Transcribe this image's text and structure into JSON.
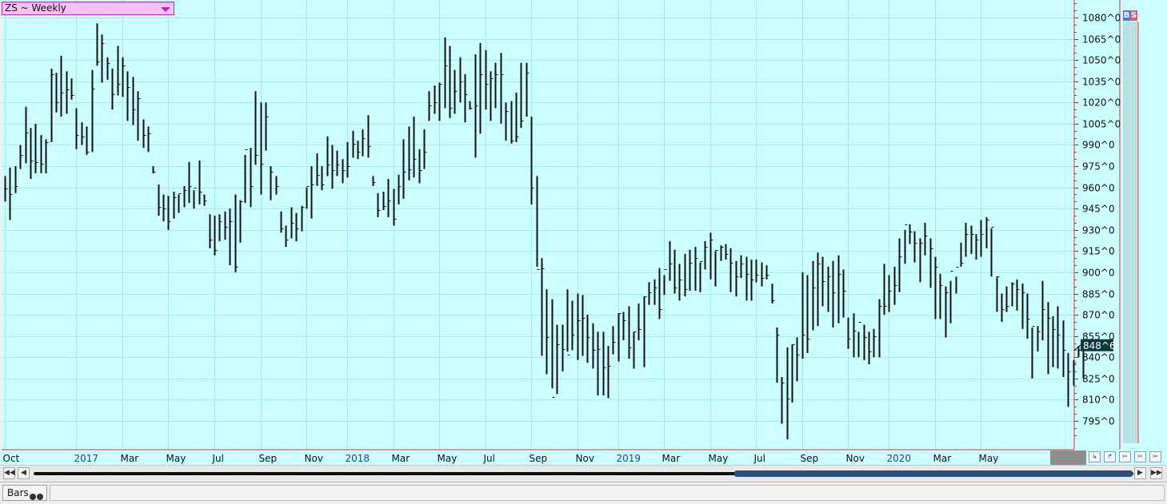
{
  "header": {
    "symbol_label": "ZS ~ Weekly"
  },
  "buy_sell": {
    "buy": "B",
    "sell": "S"
  },
  "status": {
    "tab_label": "Bars"
  },
  "colors": {
    "plot_bg": "#ccffff",
    "bar": "#111111",
    "axis": "#e03030",
    "grid": "#a8e8ee",
    "year_label": "#1a3fbf",
    "last_price_bg": "#0d3b3b"
  },
  "icons": [
    "link-icon",
    "unlink-icon",
    "zoom-in-icon",
    "zoom-out-icon",
    "reset-zoom-icon"
  ],
  "chart_data": {
    "type": "ohlc",
    "title": "ZS ~ Weekly",
    "y_unit": "cents^eighths",
    "ylim": [
      779,
      1091
    ],
    "y_ticks": [
      "1080^0",
      "1065^0",
      "1050^0",
      "1035^0",
      "1020^0",
      "1005^0",
      "990^0",
      "975^0",
      "960^0",
      "945^0",
      "930^0",
      "915^0",
      "900^0",
      "885^0",
      "870^0",
      "855^0",
      "840^0",
      "825^0",
      "810^0",
      "795^0"
    ],
    "x_ticks": [
      {
        "label": "Oct",
        "week": 0,
        "year": false
      },
      {
        "label": "2017",
        "week": 14,
        "year": true
      },
      {
        "label": "Mar",
        "week": 23,
        "year": false
      },
      {
        "label": "May",
        "week": 32,
        "year": false
      },
      {
        "label": "Jul",
        "week": 41,
        "year": false
      },
      {
        "label": "Sep",
        "week": 50,
        "year": false
      },
      {
        "label": "Nov",
        "week": 59,
        "year": false
      },
      {
        "label": "2018",
        "week": 67,
        "year": true
      },
      {
        "label": "Mar",
        "week": 76,
        "year": false
      },
      {
        "label": "May",
        "week": 85,
        "year": false
      },
      {
        "label": "Jul",
        "week": 94,
        "year": false
      },
      {
        "label": "Sep",
        "week": 103,
        "year": false
      },
      {
        "label": "Nov",
        "week": 112,
        "year": false
      },
      {
        "label": "2019",
        "week": 120,
        "year": true
      },
      {
        "label": "Mar",
        "week": 129,
        "year": false
      },
      {
        "label": "May",
        "week": 138,
        "year": false
      },
      {
        "label": "Jul",
        "week": 147,
        "year": false
      },
      {
        "label": "Sep",
        "week": 156,
        "year": false
      },
      {
        "label": "Nov",
        "week": 165,
        "year": false
      },
      {
        "label": "2020",
        "week": 173,
        "year": true
      },
      {
        "label": "Mar",
        "week": 182,
        "year": false
      },
      {
        "label": "May",
        "week": 191,
        "year": false
      }
    ],
    "last_price": {
      "label": "848^6",
      "value": 848.75
    },
    "grid": true,
    "legend": "none",
    "bars": [
      [
        968,
        950,
        959
      ],
      [
        974,
        937,
        955
      ],
      [
        975,
        956,
        961
      ],
      [
        990,
        973,
        983
      ],
      [
        1017,
        977,
        999
      ],
      [
        1002,
        966,
        979
      ],
      [
        1005,
        970,
        978
      ],
      [
        997,
        970,
        977
      ],
      [
        994,
        970,
        992
      ],
      [
        1044,
        992,
        1040
      ],
      [
        1041,
        1013,
        1020
      ],
      [
        1053,
        1010,
        1027
      ],
      [
        1042,
        1012,
        1029
      ],
      [
        1037,
        1022,
        1025
      ],
      [
        1016,
        987,
        997
      ],
      [
        1006,
        990,
        996
      ],
      [
        1003,
        983,
        985
      ],
      [
        1043,
        985,
        1030
      ],
      [
        1076,
        1046,
        1049
      ],
      [
        1068,
        1034,
        1062
      ],
      [
        1052,
        1036,
        1048
      ],
      [
        1044,
        1015,
        1026
      ],
      [
        1060,
        1025,
        1033
      ],
      [
        1052,
        1024,
        1046
      ],
      [
        1042,
        1007,
        1031
      ],
      [
        1038,
        1004,
        1015
      ],
      [
        1028,
        993,
        1023
      ],
      [
        1008,
        988,
        997
      ],
      [
        1003,
        985,
        998
      ],
      [
        975,
        970,
        971
      ],
      [
        962,
        940,
        946
      ],
      [
        955,
        936,
        945
      ],
      [
        954,
        930,
        936
      ],
      [
        957,
        938,
        953
      ],
      [
        955,
        942,
        956
      ],
      [
        961,
        946,
        958
      ],
      [
        978,
        949,
        961
      ],
      [
        958,
        945,
        960
      ],
      [
        979,
        948,
        957
      ],
      [
        955,
        947,
        951
      ],
      [
        941,
        917,
        923
      ],
      [
        940,
        912,
        916
      ],
      [
        941,
        922,
        936
      ],
      [
        943,
        923,
        932
      ],
      [
        945,
        905,
        936
      ],
      [
        955,
        900,
        904
      ],
      [
        951,
        921,
        950
      ],
      [
        983,
        949,
        987
      ],
      [
        988,
        946,
        961
      ],
      [
        1028,
        976,
        983
      ],
      [
        1020,
        955,
        977
      ],
      [
        1020,
        986,
        1010
      ],
      [
        975,
        951,
        971
      ],
      [
        968,
        955,
        961
      ],
      [
        943,
        928,
        931
      ],
      [
        933,
        918,
        923
      ],
      [
        946,
        924,
        935
      ],
      [
        942,
        922,
        931
      ],
      [
        947,
        929,
        946
      ],
      [
        960,
        945,
        961
      ],
      [
        975,
        938,
        962
      ],
      [
        984,
        961,
        969
      ],
      [
        975,
        958,
        962
      ],
      [
        996,
        968,
        976
      ],
      [
        990,
        959,
        972
      ],
      [
        986,
        968,
        976
      ],
      [
        980,
        963,
        972
      ],
      [
        992,
        967,
        975
      ],
      [
        1000,
        981,
        991
      ],
      [
        993,
        980,
        985
      ],
      [
        1001,
        982,
        995
      ],
      [
        1011,
        981,
        989
      ],
      [
        968,
        961,
        964
      ],
      [
        956,
        939,
        944
      ],
      [
        957,
        944,
        947
      ],
      [
        966,
        939,
        951
      ],
      [
        959,
        933,
        938
      ],
      [
        969,
        948,
        961
      ],
      [
        994,
        952,
        971
      ],
      [
        1003,
        965,
        973
      ],
      [
        1010,
        967,
        980
      ],
      [
        987,
        963,
        972
      ],
      [
        1001,
        973,
        985
      ],
      [
        1028,
        1007,
        1018
      ],
      [
        1032,
        1012,
        1020
      ],
      [
        1034,
        1007,
        1033
      ],
      [
        1066,
        1016,
        1046
      ],
      [
        1060,
        1009,
        1016
      ],
      [
        1043,
        1012,
        1028
      ],
      [
        1052,
        1020,
        1035
      ],
      [
        1040,
        1006,
        1026
      ],
      [
        1021,
        1015,
        1016
      ],
      [
        1054,
        981,
        1018
      ],
      [
        1062,
        998,
        1040
      ],
      [
        1057,
        1015,
        1033
      ],
      [
        1042,
        1007,
        1037
      ],
      [
        1048,
        1016,
        1040
      ],
      [
        1055,
        1005,
        1040
      ],
      [
        1020,
        993,
        1014
      ],
      [
        1021,
        991,
        993
      ],
      [
        1027,
        992,
        996
      ],
      [
        1048,
        1002,
        1007
      ],
      [
        1048,
        1010,
        1041
      ],
      [
        1010,
        948,
        960
      ],
      [
        968,
        904,
        902
      ],
      [
        910,
        841,
        903
      ],
      [
        888,
        828,
        854
      ],
      [
        881,
        818,
        812
      ],
      [
        863,
        814,
        849
      ],
      [
        863,
        830,
        846
      ],
      [
        888,
        844,
        842
      ],
      [
        880,
        845,
        856
      ],
      [
        885,
        838,
        866
      ],
      [
        884,
        841,
        868
      ],
      [
        870,
        836,
        854
      ],
      [
        864,
        832,
        845
      ],
      [
        858,
        813,
        846
      ],
      [
        858,
        813,
        833
      ],
      [
        848,
        811,
        834
      ],
      [
        862,
        842,
        851
      ],
      [
        871,
        837,
        871
      ],
      [
        872,
        852,
        866
      ],
      [
        876,
        839,
        847
      ],
      [
        858,
        832,
        858
      ],
      [
        878,
        852,
        860
      ],
      [
        883,
        833,
        883
      ],
      [
        893,
        877,
        886
      ],
      [
        895,
        877,
        889
      ],
      [
        903,
        867,
        874
      ],
      [
        898,
        884,
        902
      ],
      [
        922,
        894,
        906
      ],
      [
        916,
        885,
        889
      ],
      [
        906,
        880,
        895
      ],
      [
        913,
        883,
        888
      ],
      [
        916,
        887,
        907
      ],
      [
        918,
        887,
        910
      ],
      [
        907,
        886,
        908
      ],
      [
        922,
        902,
        918
      ],
      [
        928,
        895,
        923
      ],
      [
        915,
        890,
        916
      ],
      [
        919,
        908,
        918
      ],
      [
        920,
        909,
        913
      ],
      [
        917,
        886,
        907
      ],
      [
        908,
        883,
        897
      ],
      [
        912,
        896,
        906
      ],
      [
        911,
        880,
        899
      ],
      [
        909,
        880,
        895
      ],
      [
        909,
        893,
        898
      ],
      [
        907,
        890,
        896
      ],
      [
        905,
        895,
        898
      ],
      [
        892,
        878,
        880
      ],
      [
        861,
        822,
        856
      ],
      [
        826,
        793,
        822
      ],
      [
        847,
        782,
        811
      ],
      [
        849,
        808,
        849
      ],
      [
        854,
        823,
        842
      ],
      [
        900,
        839,
        856
      ],
      [
        898,
        843,
        853
      ],
      [
        908,
        859,
        889
      ],
      [
        914,
        862,
        906
      ],
      [
        911,
        876,
        894
      ],
      [
        904,
        872,
        897
      ],
      [
        908,
        861,
        886
      ],
      [
        912,
        864,
        899
      ],
      [
        902,
        868,
        887
      ],
      [
        868,
        846,
        853
      ],
      [
        871,
        840,
        859
      ],
      [
        858,
        840,
        865
      ],
      [
        863,
        838,
        854
      ],
      [
        858,
        835,
        844
      ],
      [
        860,
        840,
        855
      ],
      [
        881,
        840,
        876
      ],
      [
        906,
        870,
        876
      ],
      [
        898,
        872,
        887
      ],
      [
        904,
        877,
        891
      ],
      [
        924,
        886,
        911
      ],
      [
        930,
        906,
        934
      ],
      [
        934,
        920,
        929
      ],
      [
        929,
        907,
        921
      ],
      [
        924,
        893,
        921
      ],
      [
        935,
        912,
        926
      ],
      [
        924,
        889,
        917
      ],
      [
        911,
        867,
        904
      ],
      [
        899,
        867,
        891
      ],
      [
        890,
        854,
        886
      ],
      [
        894,
        864,
        901
      ],
      [
        897,
        885,
        904
      ],
      [
        921,
        904,
        907
      ],
      [
        935,
        911,
        927
      ],
      [
        933,
        913,
        927
      ],
      [
        927,
        909,
        923
      ],
      [
        937,
        911,
        927
      ],
      [
        939,
        917,
        937
      ],
      [
        931,
        897,
        932
      ],
      [
        897,
        872,
        897
      ],
      [
        885,
        865,
        874
      ],
      [
        890,
        872,
        876
      ],
      [
        893,
        876,
        892
      ],
      [
        895,
        873,
        888
      ],
      [
        892,
        860,
        886
      ],
      [
        885,
        853,
        867
      ],
      [
        861,
        825,
        862
      ],
      [
        862,
        844,
        858
      ],
      [
        894,
        852,
        874
      ],
      [
        879,
        828,
        868
      ],
      [
        869,
        833,
        860
      ],
      [
        876,
        832,
        856
      ],
      [
        866,
        826,
        845
      ],
      [
        843,
        805,
        830
      ],
      [
        838,
        820,
        836
      ],
      [
        848,
        840,
        845
      ],
      [
        852,
        825,
        848.75
      ]
    ]
  }
}
